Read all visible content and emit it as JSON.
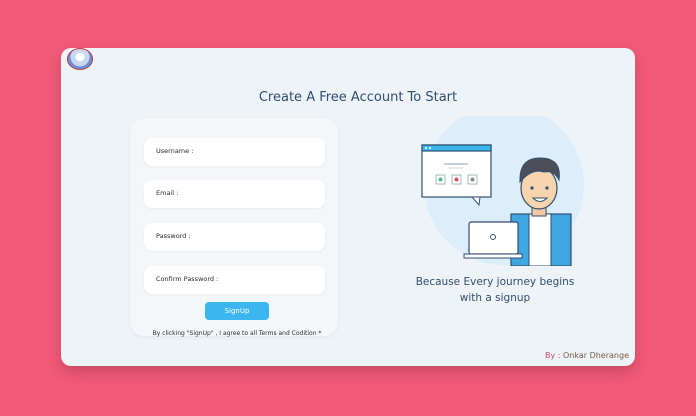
{
  "title": "Create A Free Account To Start",
  "form": {
    "username_label": "Username :",
    "email_label": "Email :",
    "password_label": "Password :",
    "confirm_label": "Confirm Password :",
    "signup_label": "SignUp",
    "terms": "By clicking  \"SignUp\" , I agree to all Terms and Codition *"
  },
  "tagline_line1": "Because Every journey begins",
  "tagline_line2": "with a signup",
  "credit_prefix": "By : ",
  "credit_name": "Onkar Dherange",
  "colors": {
    "background": "#f25a78",
    "card": "#eef3f8",
    "button": "#3bb6ef",
    "title": "#2f4f6f"
  }
}
